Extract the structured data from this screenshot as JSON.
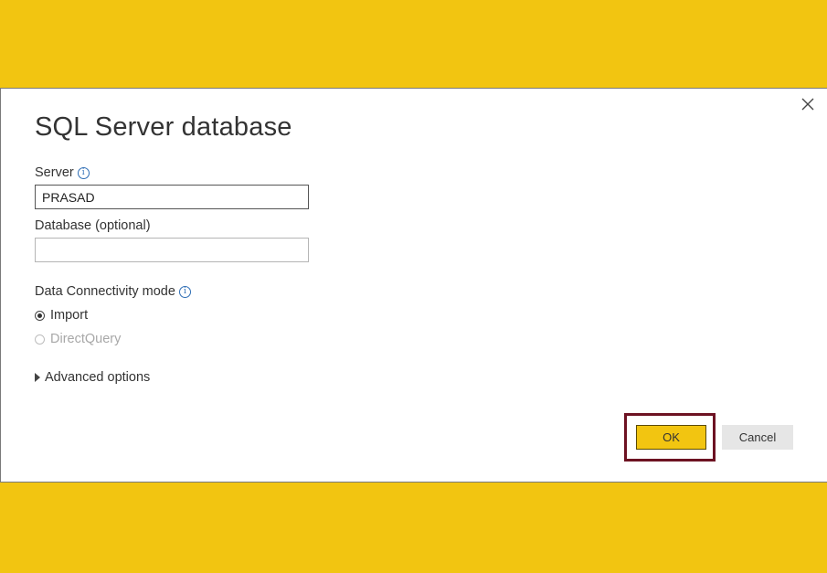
{
  "dialog": {
    "title": "SQL Server database",
    "close_icon": "close-icon"
  },
  "server": {
    "label": "Server",
    "value": "PRASAD",
    "info_icon": "info-icon"
  },
  "database": {
    "label": "Database (optional)",
    "value": ""
  },
  "connectivity": {
    "label": "Data Connectivity mode",
    "options": [
      {
        "label": "Import",
        "selected": true,
        "enabled": true
      },
      {
        "label": "DirectQuery",
        "selected": false,
        "enabled": false
      }
    ]
  },
  "advanced": {
    "label": "Advanced options"
  },
  "buttons": {
    "ok_label": "OK",
    "cancel_label": "Cancel"
  },
  "colors": {
    "background": "#F2C511",
    "ok_button": "#F2C511",
    "highlight_border": "#6d1222"
  }
}
